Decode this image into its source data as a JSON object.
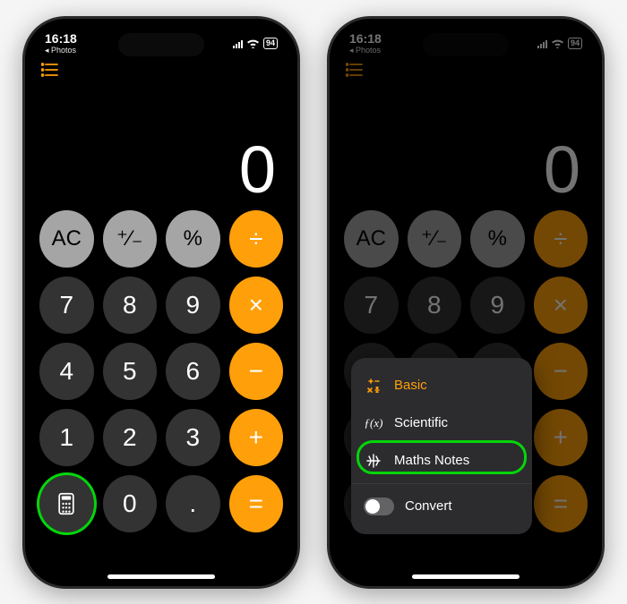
{
  "status": {
    "time": "16:18",
    "back_app": "Photos",
    "battery": "94"
  },
  "calculator": {
    "display": "0",
    "keys": {
      "ac": "AC",
      "sign": "⁺∕₋",
      "percent": "%",
      "divide": "÷",
      "7": "7",
      "8": "8",
      "9": "9",
      "multiply": "×",
      "4": "4",
      "5": "5",
      "6": "6",
      "minus": "−",
      "1": "1",
      "2": "2",
      "3": "3",
      "plus": "+",
      "0": "0",
      "decimal": ".",
      "equals": "="
    }
  },
  "mode_menu": {
    "basic": "Basic",
    "scientific": "Scientific",
    "maths_notes": "Maths Notes",
    "convert": "Convert",
    "fx_label": "ƒ(x)"
  }
}
